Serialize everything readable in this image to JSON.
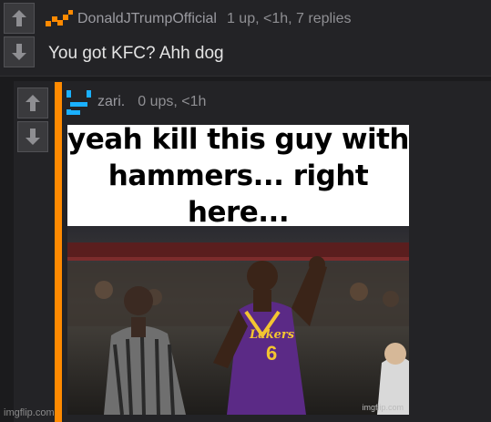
{
  "comments": [
    {
      "username": "DonaldJTrumpOfficial",
      "stats": "1 up, <1h, 7 replies",
      "text": "You got KFC? Ahh dog",
      "avatar": "orange-check-avatar-icon"
    },
    {
      "username": "zari.",
      "stats": "0 ups, <1h",
      "avatar": "blue-bracket-avatar-icon",
      "meme": {
        "caption_line1": "yeah kill this guy with",
        "caption_line2": "hammers... right here...",
        "jersey_text": "Lakers",
        "jersey_number": "6",
        "watermark": "imgflip.com"
      }
    }
  ],
  "footer": {
    "watermark": "imgflip.com"
  },
  "colors": {
    "background": "#1b1b1d",
    "panel": "#232326",
    "accent_orange": "#ff8a00",
    "accent_blue": "#1ab0ff"
  }
}
